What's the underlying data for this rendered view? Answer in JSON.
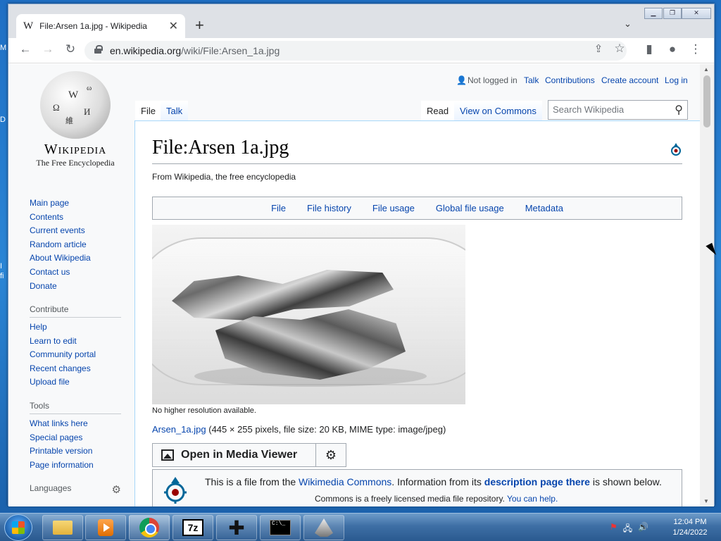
{
  "desktop": {
    "edge_texts": [
      "M",
      "D",
      "I",
      "fi"
    ]
  },
  "browser": {
    "tab_title": "File:Arsen 1a.jpg - Wikipedia",
    "tab_favicon": "W",
    "url_domain": "en.wikipedia.org",
    "url_path": "/wiki/File:Arsen_1a.jpg"
  },
  "wiki": {
    "logo_glyphs": [
      "Ω",
      "W",
      "И",
      "維",
      "ω"
    ],
    "wordmark": "Wikipedia",
    "tagline": "The Free Encyclopedia",
    "nav": [
      "Main page",
      "Contents",
      "Current events",
      "Random article",
      "About Wikipedia",
      "Contact us",
      "Donate"
    ],
    "contribute": {
      "heading": "Contribute",
      "items": [
        "Help",
        "Learn to edit",
        "Community portal",
        "Recent changes",
        "Upload file"
      ]
    },
    "tools": {
      "heading": "Tools",
      "items": [
        "What links here",
        "Special pages",
        "Printable version",
        "Page information"
      ]
    },
    "languages_heading": "Languages",
    "user": {
      "status": "Not logged in",
      "talk": "Talk",
      "contributions": "Contributions",
      "create_account": "Create account",
      "log_in": "Log in"
    },
    "tabs": {
      "file": "File",
      "talk": "Talk",
      "read": "Read",
      "view_on_commons": "View on Commons"
    },
    "search_placeholder": "Search Wikipedia",
    "page_title": "File:Arsen 1a.jpg",
    "from": "From Wikipedia, the free encyclopedia",
    "file_toc": [
      "File",
      "File history",
      "File usage",
      "Global file usage",
      "Metadata"
    ],
    "no_higher_res": "No higher resolution available.",
    "file_link": "Arsen_1a.jpg",
    "file_details": " (445 × 255 pixels, file size: 20 KB, MIME type: image/jpeg)",
    "media_viewer_button": "Open in Media Viewer",
    "commons_box": {
      "l1_a": "This is a file from the ",
      "l1_link": "Wikimedia Commons",
      "l1_b": ". Information from its ",
      "l1_bold": "description page there",
      "l1_c": " is shown below.",
      "l2_a": "Commons is a freely licensed media file repository. ",
      "l2_link": "You can help."
    }
  },
  "taskbar": {
    "apps": [
      "windows-explorer",
      "media-player",
      "chrome",
      "7zip",
      "game-controller",
      "command-prompt",
      "inkscape"
    ],
    "clock_time": "12:04 PM",
    "clock_date": "1/24/2022"
  }
}
